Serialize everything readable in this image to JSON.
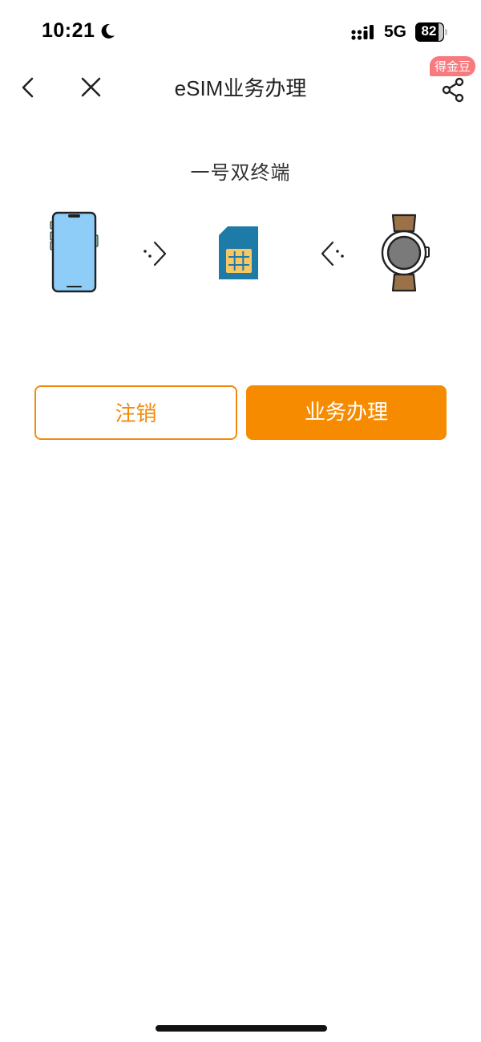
{
  "status_bar": {
    "time": "10:21",
    "network": "5G",
    "battery": "82",
    "battery_percent": 82
  },
  "nav": {
    "title": "eSIM业务办理",
    "reward_badge": "得金豆"
  },
  "section": {
    "title": "一号双终端"
  },
  "diagram": {
    "devices": [
      {
        "icon": "phone-icon"
      },
      {
        "icon": "arrow-right-icon"
      },
      {
        "icon": "sim-card-icon"
      },
      {
        "icon": "arrow-left-icon"
      },
      {
        "icon": "smartwatch-icon"
      }
    ]
  },
  "actions": {
    "cancel_label": "注销",
    "apply_label": "业务办理"
  },
  "colors": {
    "accent": "#f78b00",
    "badge": "#f77a7f",
    "sim": "#1e7ba8",
    "phone_screen": "#8ecdf8",
    "watch_band": "#9b7248"
  }
}
